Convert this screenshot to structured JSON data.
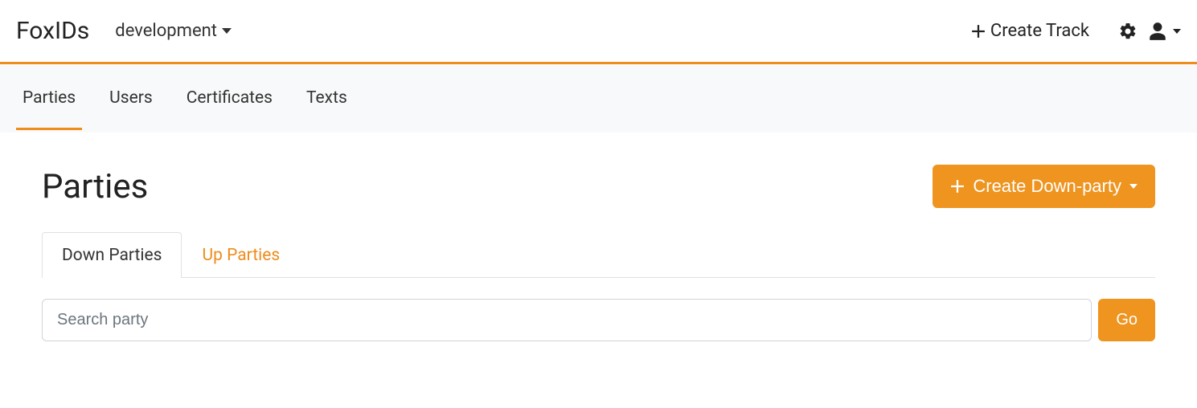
{
  "header": {
    "brand": "FoxIDs",
    "track_selected": "development",
    "create_track_label": "Create Track"
  },
  "nav": {
    "tabs": [
      {
        "label": "Parties",
        "active": true
      },
      {
        "label": "Users",
        "active": false
      },
      {
        "label": "Certificates",
        "active": false
      },
      {
        "label": "Texts",
        "active": false
      }
    ]
  },
  "main": {
    "title": "Parties",
    "create_button_label": "Create Down-party",
    "sub_tabs": [
      {
        "label": "Down Parties",
        "active": true
      },
      {
        "label": "Up Parties",
        "active": false
      }
    ],
    "search": {
      "placeholder": "Search party",
      "value": "",
      "go_label": "Go"
    }
  },
  "colors": {
    "accent": "#ee8c1c"
  }
}
